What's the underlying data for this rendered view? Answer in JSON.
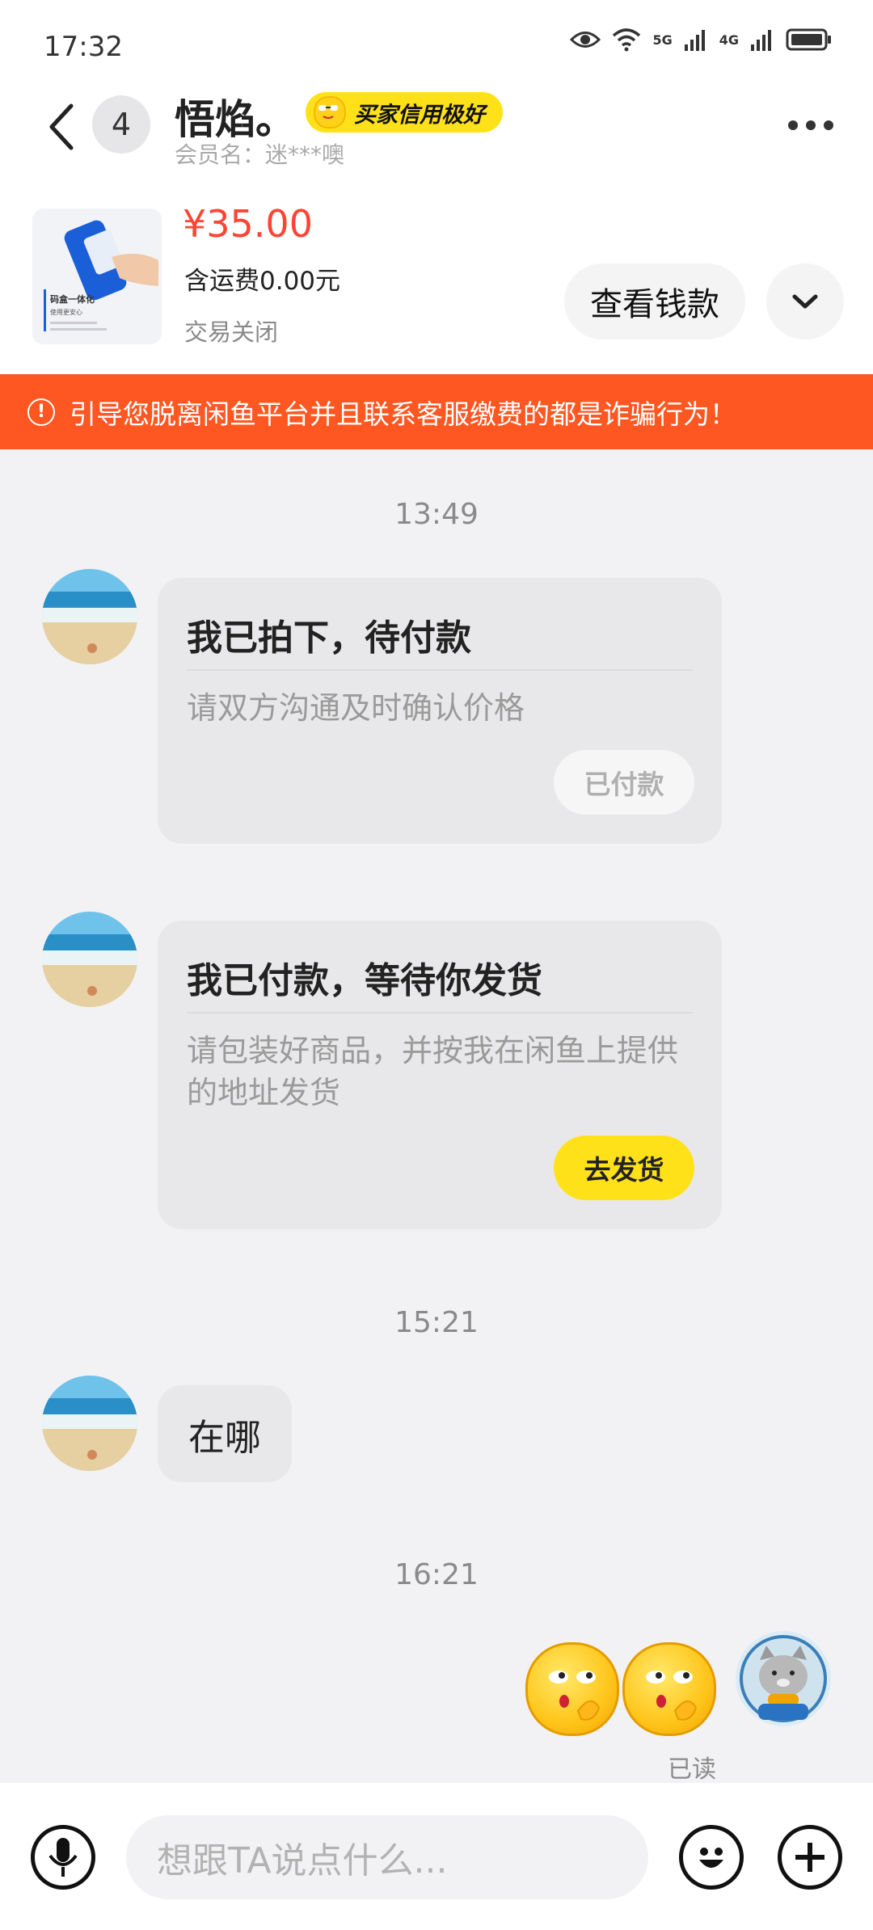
{
  "status_bar": {
    "time": "17:32",
    "net1": "5G",
    "net2": "4G"
  },
  "header": {
    "unread_count": "4",
    "nickname": "悟焰。",
    "credit_badge": "买家信用极好",
    "member_name": "会员名：迷***噢"
  },
  "item": {
    "price": "¥35.00",
    "shipping": "含运费0.00元",
    "status": "交易关闭",
    "view_button": "查看钱款",
    "thumb_caption_1": "码盒一体化",
    "thumb_caption_2": "使用更安心"
  },
  "warning": {
    "text": "引导您脱离闲鱼平台并且联系客服缴费的都是诈骗行为！"
  },
  "chat": {
    "time_1": "13:49",
    "card_1": {
      "title": "我已拍下，待付款",
      "desc": "请双方沟通及时确认价格",
      "button": "已付款"
    },
    "card_2": {
      "title": "我已付款，等待你发货",
      "desc": "请包装好商品，并按我在闲鱼上提供的地址发货",
      "button": "去发货"
    },
    "time_2": "15:21",
    "message_text": "在哪",
    "time_3": "16:21",
    "read_status": "已读"
  },
  "input": {
    "placeholder": "想跟TA说点什么..."
  },
  "colors": {
    "accent_red": "#ff4433",
    "warning_bar": "#ff5722",
    "yellow_button": "#ffe11a"
  }
}
